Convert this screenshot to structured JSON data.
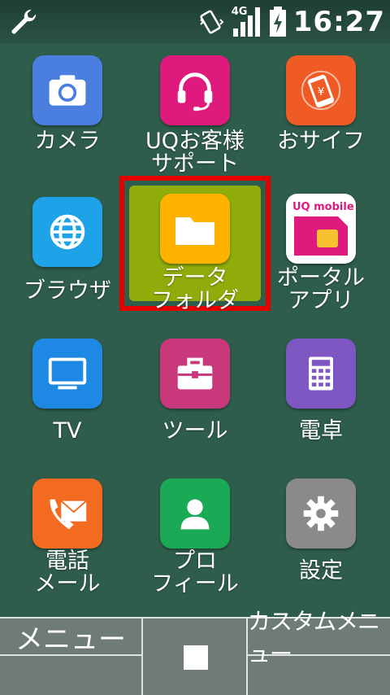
{
  "status_bar": {
    "network": "4G",
    "time": "16:27",
    "icons": [
      "wrench-icon",
      "vibrate-icon",
      "signal-icon",
      "battery-charging-icon"
    ]
  },
  "apps": [
    {
      "label": "カメラ",
      "label2": "",
      "icon": "camera-icon",
      "color": "#4a7fe0"
    },
    {
      "label": "UQお客様",
      "label2": "サポート",
      "icon": "headset-icon",
      "color": "#e0197d"
    },
    {
      "label": "おサイフ",
      "label2": "",
      "icon": "wallet-phone-icon",
      "color": "#f05a24"
    },
    {
      "label": "ブラウザ",
      "label2": "",
      "icon": "globe-icon",
      "color": "#1fa3e8"
    },
    {
      "label": "データ",
      "label2": "フォルダ",
      "icon": "folder-icon",
      "color": "#ffb300"
    },
    {
      "label": "ポータル",
      "label2": "アプリ",
      "icon": "uq-mobile-sim-icon",
      "color": "#ffffff"
    },
    {
      "label": "TV",
      "label2": "",
      "icon": "tv-icon",
      "color": "#1e88e5"
    },
    {
      "label": "ツール",
      "label2": "",
      "icon": "toolbox-icon",
      "color": "#c8387a"
    },
    {
      "label": "電卓",
      "label2": "",
      "icon": "calculator-icon",
      "color": "#7e57c2"
    },
    {
      "label": "電話",
      "label2": "メール",
      "icon": "phone-mail-icon",
      "color": "#f26b21"
    },
    {
      "label": "プロ",
      "label2": "フィール",
      "icon": "profile-icon",
      "color": "#1aaa55"
    },
    {
      "label": "設定",
      "label2": "",
      "icon": "gear-icon",
      "color": "#8a8a8a"
    }
  ],
  "uq_logo_text": "UQ mobile",
  "softkeys": {
    "left": "メニュー",
    "center": "■",
    "right": "カスタムメニュー"
  }
}
